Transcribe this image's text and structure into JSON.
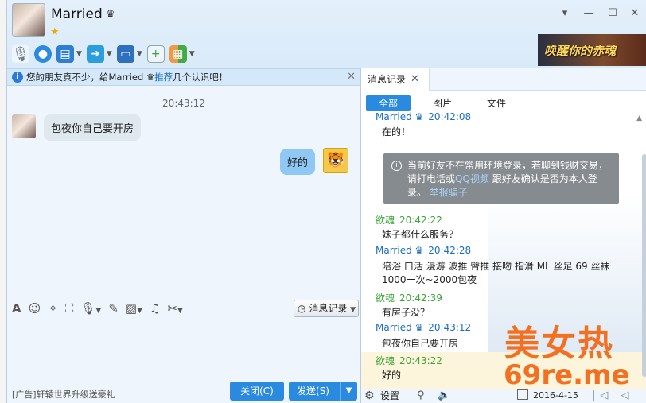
{
  "contact": {
    "name": "Married",
    "crown": "♛",
    "star": "★"
  },
  "window": {
    "minimize": "—",
    "maximize": "☐",
    "close": "✕",
    "dropdown": "▾"
  },
  "toolbar": {
    "icons": [
      "microphone-icon",
      "webcam-icon",
      "screen-share-icon",
      "file-transfer-icon",
      "remote-desktop-icon",
      "add-app-icon",
      "apps-grid-icon"
    ]
  },
  "ad_banner": {
    "text": "唤醒你的赤魂"
  },
  "notice": {
    "prefix": "您的朋友真不少，给Married ♛",
    "link": "推荐",
    "suffix": "几个认识吧！"
  },
  "chat": {
    "time": "20:43:12",
    "messages": [
      {
        "side": "left",
        "text": "包夜你自己要开房"
      },
      {
        "side": "right",
        "text": "好的"
      }
    ]
  },
  "input_toolbar": {
    "icons": [
      "font-icon",
      "emoji-icon",
      "magic-icon",
      "screenshot-icon",
      "voice-icon",
      "edit-icon",
      "image-icon",
      "music-icon",
      "scissors-icon"
    ],
    "history_label": "消息记录"
  },
  "bottom": {
    "ad_text": "[广告]轩辕世界升级送豪礼",
    "close_label": "关闭(C)",
    "send_label": "发送(S)"
  },
  "right_panel": {
    "tab_label": "消息记录",
    "filters": [
      "全部",
      "图片",
      "文件"
    ],
    "entries": [
      {
        "name": "Married ♛",
        "time": "20:42:08",
        "color": "blue",
        "text": "在的！"
      },
      {
        "name": "欲魂",
        "time": "20:42:22",
        "color": "green",
        "text": "妹子都什么服务？"
      },
      {
        "name": "Married ♛",
        "time": "20:42:28",
        "color": "blue",
        "text": "陪浴 口活  漫游 波推 臀推 接吻 指滑 ML 丝足 69 丝袜1000一次~2000包夜"
      },
      {
        "name": "欲魂",
        "time": "20:42:39",
        "color": "green",
        "text": "有房子没？"
      },
      {
        "name": "Married ♛",
        "time": "20:43:12",
        "color": "blue",
        "text": "包夜你自己要开房"
      },
      {
        "name": "欲魂",
        "time": "20:43:22",
        "color": "green",
        "text": "好的"
      }
    ],
    "security": {
      "text1": "当前好友不在常用环境登录，若聊到钱财交易，请打电话或",
      "link1": "QQ视频",
      "text2": " 跟好友确认是否为本人登录。",
      "link2": "举报骗子"
    },
    "footer": {
      "settings_label": "设置",
      "date": "2016-4-15",
      "nav": "|◁ ◁ ▷ ▷|"
    }
  },
  "watermark": {
    "line1": "美女热",
    "line2": "69re.me"
  },
  "colors": {
    "accent": "#2a8ae0",
    "green_name": "#3aa536",
    "blue_name": "#1a6ec2",
    "watermark": "#f37021"
  }
}
